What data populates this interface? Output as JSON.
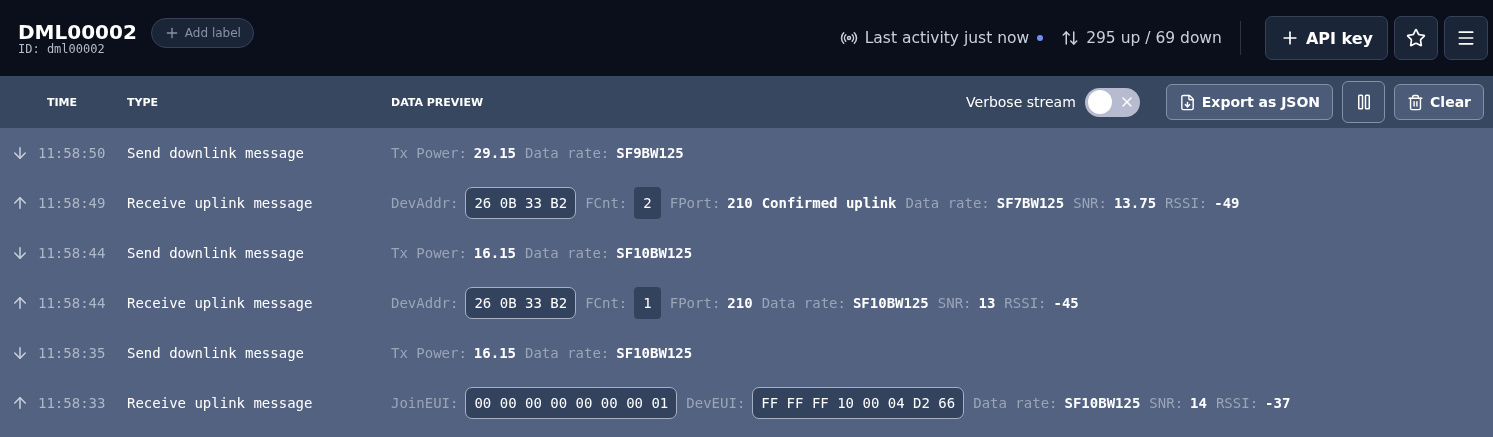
{
  "device": {
    "name": "DML00002",
    "id": "ID: dml00002",
    "add_label": "Add label"
  },
  "status": {
    "activity": "Last activity just now",
    "live": true,
    "traffic": "295 up / 69 down"
  },
  "header_buttons": {
    "api_key": "API key"
  },
  "columns": [
    "TIME",
    "TYPE",
    "DATA PREVIEW"
  ],
  "toolbar": {
    "verbose_label": "Verbose stream",
    "verbose_on": false,
    "export": "Export as JSON",
    "clear": "Clear"
  },
  "rows": [
    {
      "kind": "down",
      "time": "11:58:50",
      "type": "Send downlink message",
      "preview": [
        {
          "kind": "label",
          "text": "Tx Power:"
        },
        {
          "kind": "value",
          "text": "29.15"
        },
        {
          "kind": "label",
          "text": "Data rate:"
        },
        {
          "kind": "value",
          "text": "SF9BW125"
        }
      ]
    },
    {
      "kind": "up",
      "time": "11:58:49",
      "type": "Receive uplink message",
      "preview": [
        {
          "kind": "label",
          "text": "DevAddr:"
        },
        {
          "kind": "chip",
          "text": "26 0B 33 B2"
        },
        {
          "kind": "label",
          "text": "FCnt:"
        },
        {
          "kind": "badge",
          "text": "2"
        },
        {
          "kind": "label",
          "text": "FPort:"
        },
        {
          "kind": "value",
          "text": "210"
        },
        {
          "kind": "value",
          "text": "Confirmed uplink"
        },
        {
          "kind": "label",
          "text": "Data rate:"
        },
        {
          "kind": "value",
          "text": "SF7BW125"
        },
        {
          "kind": "label",
          "text": "SNR:"
        },
        {
          "kind": "value",
          "text": "13.75"
        },
        {
          "kind": "label",
          "text": "RSSI:"
        },
        {
          "kind": "value",
          "text": "-49"
        }
      ]
    },
    {
      "kind": "down",
      "time": "11:58:44",
      "type": "Send downlink message",
      "preview": [
        {
          "kind": "label",
          "text": "Tx Power:"
        },
        {
          "kind": "value",
          "text": "16.15"
        },
        {
          "kind": "label",
          "text": "Data rate:"
        },
        {
          "kind": "value",
          "text": "SF10BW125"
        }
      ]
    },
    {
      "kind": "up",
      "time": "11:58:44",
      "type": "Receive uplink message",
      "preview": [
        {
          "kind": "label",
          "text": "DevAddr:"
        },
        {
          "kind": "chip",
          "text": "26 0B 33 B2"
        },
        {
          "kind": "label",
          "text": "FCnt:"
        },
        {
          "kind": "badge",
          "text": "1"
        },
        {
          "kind": "label",
          "text": "FPort:"
        },
        {
          "kind": "value",
          "text": "210"
        },
        {
          "kind": "label",
          "text": "Data rate:"
        },
        {
          "kind": "value",
          "text": "SF10BW125"
        },
        {
          "kind": "label",
          "text": "SNR:"
        },
        {
          "kind": "value",
          "text": "13"
        },
        {
          "kind": "label",
          "text": "RSSI:"
        },
        {
          "kind": "value",
          "text": "-45"
        }
      ]
    },
    {
      "kind": "down",
      "time": "11:58:35",
      "type": "Send downlink message",
      "preview": [
        {
          "kind": "label",
          "text": "Tx Power:"
        },
        {
          "kind": "value",
          "text": "16.15"
        },
        {
          "kind": "label",
          "text": "Data rate:"
        },
        {
          "kind": "value",
          "text": "SF10BW125"
        }
      ]
    },
    {
      "kind": "up",
      "time": "11:58:33",
      "type": "Receive uplink message",
      "preview": [
        {
          "kind": "label",
          "text": "JoinEUI:"
        },
        {
          "kind": "chip",
          "text": "00 00 00 00 00 00 00 01"
        },
        {
          "kind": "label",
          "text": "DevEUI:"
        },
        {
          "kind": "chip",
          "text": "FF FF FF 10 00 04 D2 66"
        },
        {
          "kind": "label",
          "text": "Data rate:"
        },
        {
          "kind": "value",
          "text": "SF10BW125"
        },
        {
          "kind": "label",
          "text": "SNR:"
        },
        {
          "kind": "value",
          "text": "14"
        },
        {
          "kind": "label",
          "text": "RSSI:"
        },
        {
          "kind": "value",
          "text": "-37"
        }
      ]
    }
  ]
}
